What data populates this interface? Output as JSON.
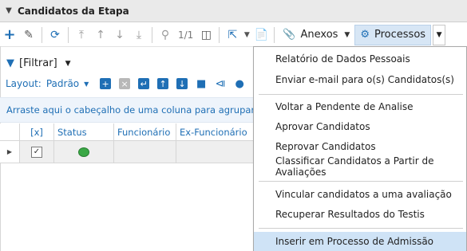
{
  "panel": {
    "title": "Candidatos da Etapa"
  },
  "toolbar": {
    "pager": "1/1",
    "anexos_label": "Anexos",
    "processos_label": "Processos"
  },
  "filter": {
    "label": "[Filtrar]"
  },
  "layout": {
    "label": "Layout:",
    "value": "Padrão"
  },
  "group_hint": "Arraste aqui o cabeçalho de uma coluna para agrupar",
  "grid": {
    "columns": [
      "[x]",
      "Status",
      "Funcionário",
      "Ex-Funcionário"
    ],
    "rows": [
      {
        "checked": "✓",
        "status_color": "#3aa845"
      }
    ]
  },
  "menu": {
    "items": [
      "Relatório de Dados Pessoais",
      "Enviar e-mail para o(s) Candidatos(s)",
      "Voltar a Pendente de Analise",
      "Aprovar Candidatos",
      "Reprovar Candidatos",
      "Classificar Candidatos a Partir de Avaliações",
      "Vincular candidatos a uma avaliação",
      "Recuperar Resultados do Testis",
      "Inserir em Processo de Admissão"
    ]
  },
  "colors": {
    "accent": "#1f6fb5",
    "highlight": "#cfe3f6",
    "status_green": "#3aa845"
  }
}
